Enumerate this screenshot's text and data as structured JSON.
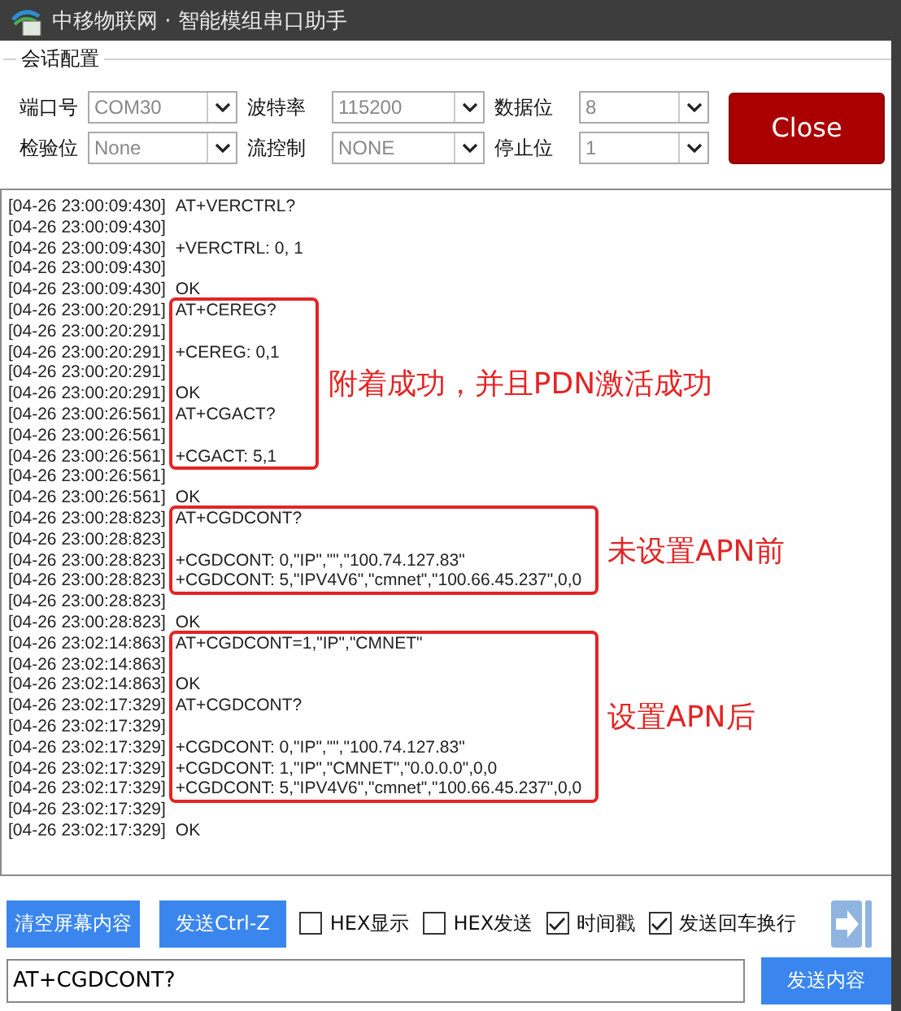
{
  "window": {
    "title": "中移物联网 · 智能模组串口助手"
  },
  "session_config": {
    "title": "会话配置",
    "fields": [
      {
        "label": "端口号",
        "value": "COM30"
      },
      {
        "label": "波特率",
        "value": "115200"
      },
      {
        "label": "数据位",
        "value": "8"
      },
      {
        "label": "检验位",
        "value": "None"
      },
      {
        "label": "流控制",
        "value": "NONE"
      },
      {
        "label": "停止位",
        "value": "1"
      }
    ],
    "close_button": "Close"
  },
  "log": [
    {
      "lines": [
        {
          "time": "[04-26 23:00:09:430]",
          "text": "AT+VERCTRL?"
        },
        {
          "time": "[04-26 23:00:09:430]"
        },
        {
          "time": "[04-26 23:00:09:430]",
          "text": "+VERCTRL: 0, 1"
        },
        {
          "time": "[04-26 23:00:09:430]"
        },
        {
          "time": "[04-26 23:00:09:430]",
          "text": "OK"
        }
      ]
    },
    {
      "annotation": "附着成功，并且PDN激活成功",
      "lines": [
        {
          "time": "[04-26 23:00:20:291]",
          "text": "AT+CEREG?"
        },
        {
          "time": "[04-26 23:00:20:291]"
        },
        {
          "time": "[04-26 23:00:20:291]",
          "text": "+CEREG: 0,1"
        },
        {
          "time": "[04-26 23:00:20:291]"
        },
        {
          "time": "[04-26 23:00:20:291]",
          "text": "OK"
        },
        {
          "time": "[04-26 23:00:26:561]",
          "text": "AT+CGACT?"
        },
        {
          "time": "[04-26 23:00:26:561]"
        },
        {
          "time": "[04-26 23:00:26:561]",
          "text": "+CGACT: 5,1"
        }
      ]
    },
    {
      "lines": [
        {
          "time": "[04-26 23:00:26:561]"
        },
        {
          "time": "[04-26 23:00:26:561]",
          "text": "OK"
        }
      ]
    },
    {
      "annotation": "未设置APN前",
      "lines": [
        {
          "time": "[04-26 23:00:28:823]",
          "text": "AT+CGDCONT?"
        },
        {
          "time": "[04-26 23:00:28:823]"
        },
        {
          "time": "[04-26 23:00:28:823]",
          "text": "+CGDCONT: 0,\"IP\",\"\",\"100.74.127.83\""
        },
        {
          "time": "[04-26 23:00:28:823]",
          "text": "+CGDCONT: 5,\"IPV4V6\",\"cmnet\",\"100.66.45.237\",0,0"
        }
      ]
    },
    {
      "lines": [
        {
          "time": "[04-26 23:00:28:823]"
        },
        {
          "time": "[04-26 23:00:28:823]",
          "text": "OK"
        }
      ]
    },
    {
      "annotation": "设置APN后",
      "lines": [
        {
          "time": "[04-26 23:02:14:863]",
          "text": "AT+CGDCONT=1,\"IP\",\"CMNET\""
        },
        {
          "time": "[04-26 23:02:14:863]"
        },
        {
          "time": "[04-26 23:02:14:863]",
          "text": "OK"
        },
        {
          "time": "[04-26 23:02:17:329]",
          "text": "AT+CGDCONT?"
        },
        {
          "time": "[04-26 23:02:17:329]"
        },
        {
          "time": "[04-26 23:02:17:329]",
          "text": "+CGDCONT: 0,\"IP\",\"\",\"100.74.127.83\""
        },
        {
          "time": "[04-26 23:02:17:329]",
          "text": "+CGDCONT: 1,\"IP\",\"CMNET\",\"0.0.0.0\",0,0"
        },
        {
          "time": "[04-26 23:02:17:329]",
          "text": "+CGDCONT: 5,\"IPV4V6\",\"cmnet\",\"100.66.45.237\",0,0"
        }
      ]
    },
    {
      "lines": [
        {
          "time": "[04-26 23:02:17:329]"
        },
        {
          "time": "[04-26 23:02:17:329]",
          "text": "OK"
        }
      ]
    }
  ],
  "toolbar": {
    "buttons": [
      "清空屏幕内容",
      "发送Ctrl-Z"
    ],
    "options": [
      {
        "label": "HEX显示",
        "checked": false
      },
      {
        "label": "HEX发送",
        "checked": false
      },
      {
        "label": "时间戳",
        "checked": true
      },
      {
        "label": "发送回车换行",
        "checked": true
      }
    ]
  },
  "send": {
    "value": "AT+CGDCONT?",
    "button": "发送内容"
  }
}
